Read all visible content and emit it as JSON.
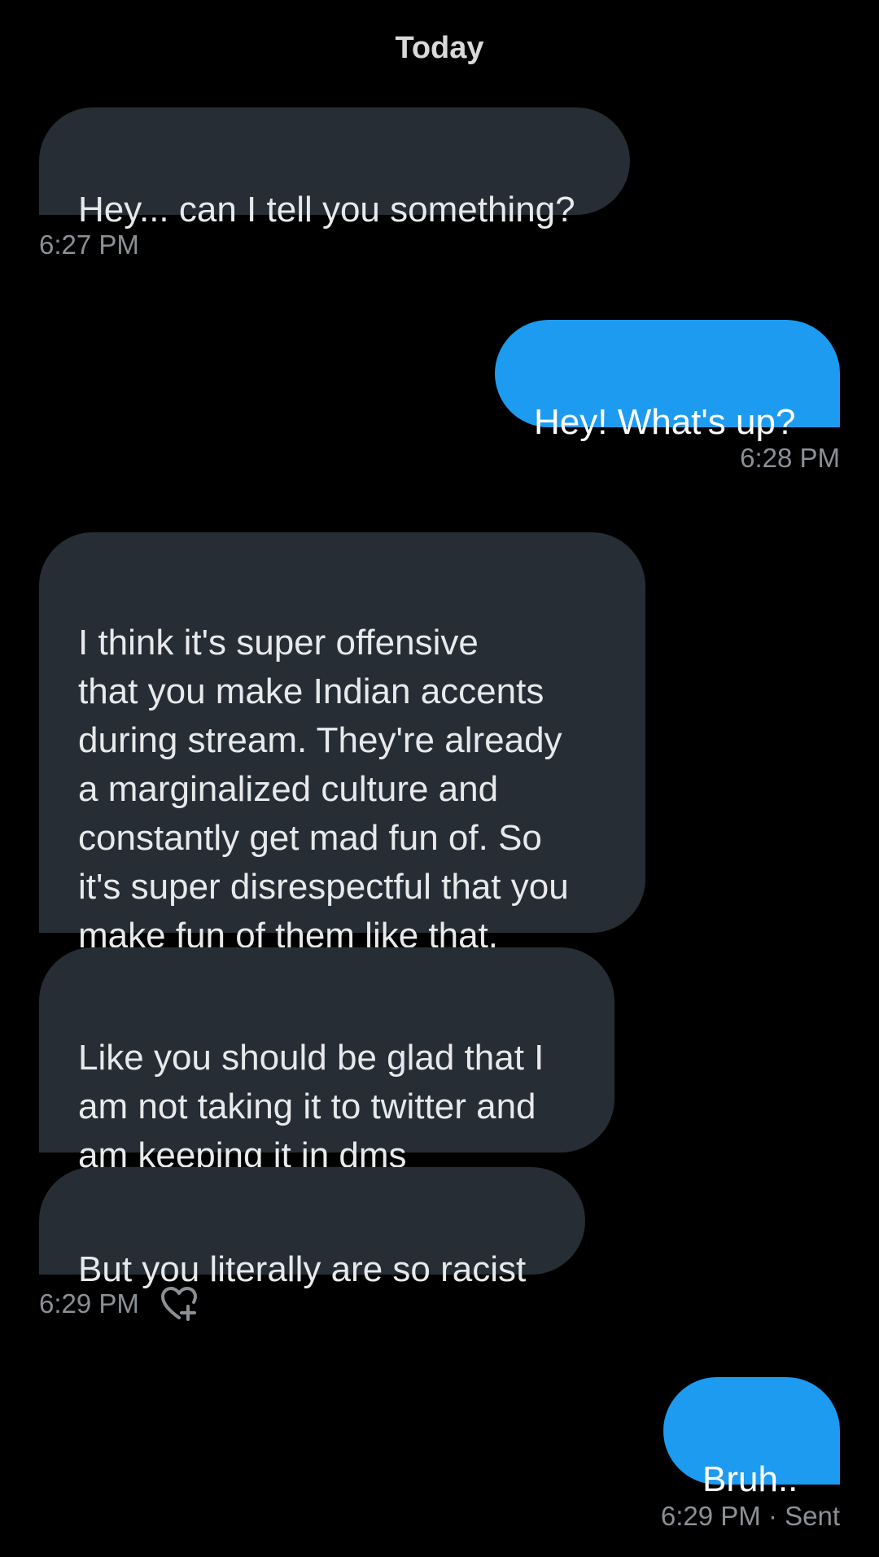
{
  "conversation": {
    "day_label": "Today",
    "messages": [
      {
        "id": "m1",
        "direction": "received",
        "text": "Hey... can I tell you something?"
      },
      {
        "id": "m2",
        "direction": "sent",
        "text": "Hey! What's up?"
      },
      {
        "id": "m3",
        "direction": "received",
        "text": "I think it's super offensive\nthat you make Indian accents\nduring stream. They're already\na marginalized culture and\nconstantly get mad fun of. So\nit's super disrespectful that you\nmake fun of them like that."
      },
      {
        "id": "m4",
        "direction": "received",
        "text": "Like you should be glad that I\nam not taking it to twitter and\nam keeping it in dms"
      },
      {
        "id": "m5",
        "direction": "received",
        "text": "But you literally are so racist"
      },
      {
        "id": "m6",
        "direction": "sent",
        "text": "Bruh.."
      }
    ],
    "timestamps": {
      "t1": "6:27 PM",
      "t2": "6:28 PM",
      "t3": "6:29 PM",
      "t4": "6:29 PM · Sent"
    },
    "icons": {
      "react": "heart-plus-icon"
    },
    "colors": {
      "background": "#000000",
      "received_bubble": "#262d34",
      "sent_bubble": "#1d9bf0",
      "timestamp": "#8b9096"
    }
  }
}
